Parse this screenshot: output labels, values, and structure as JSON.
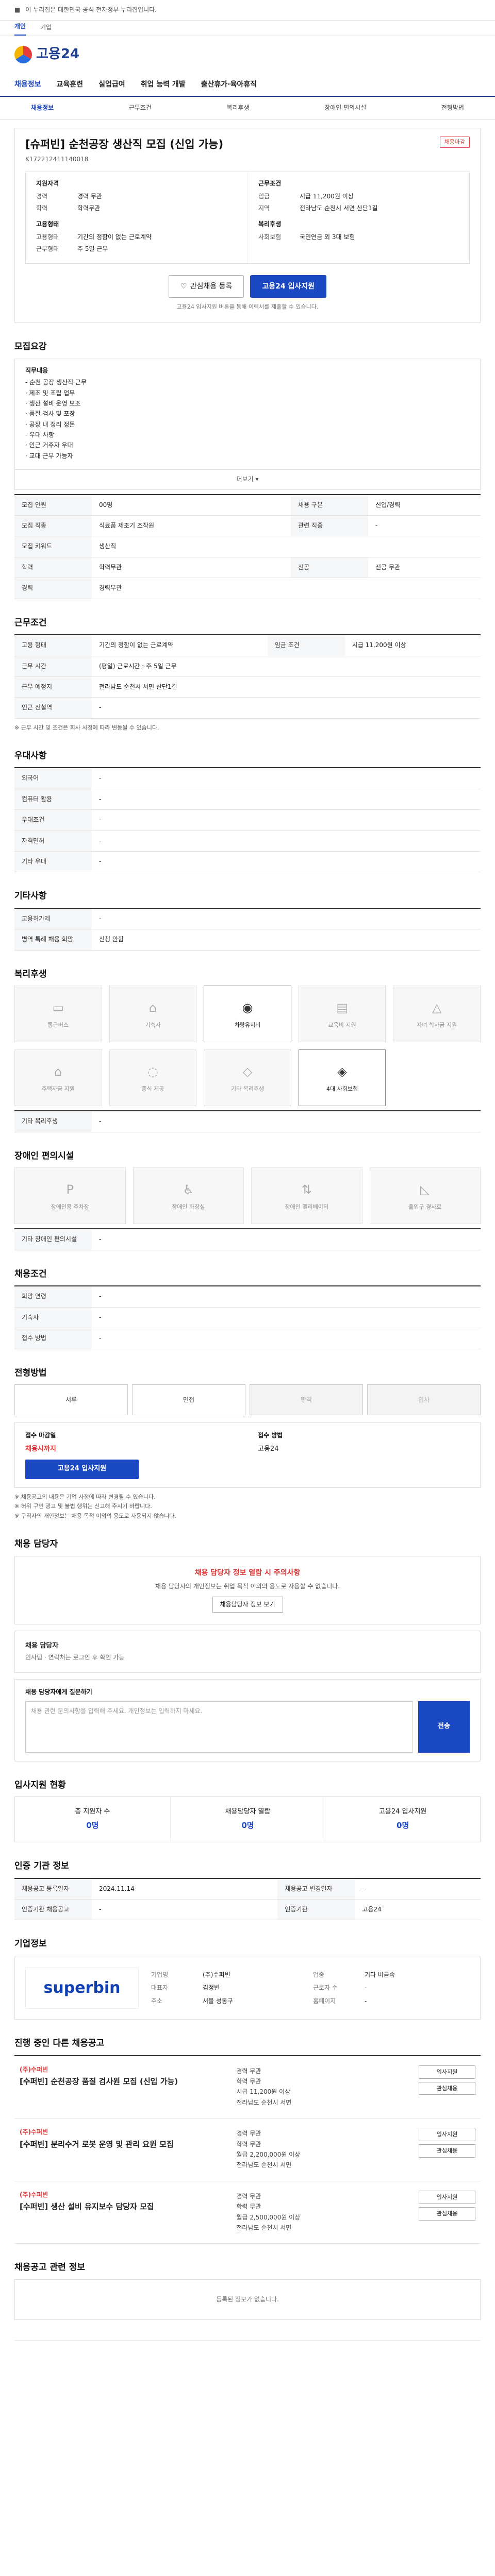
{
  "topbar": {
    "text": "이 누리집은 대한민국 공식 전자정부 누리집입니다."
  },
  "subtabs": [
    "개인",
    "기업"
  ],
  "logo": "고용24",
  "gnb": [
    "채용정보",
    "교육훈련",
    "실업급여",
    "취업 능력 개발",
    "출산휴가·육아휴직"
  ],
  "lnb": [
    "채용정보",
    "근무조건",
    "복리후생",
    "장애인 편의시설",
    "전형방법"
  ],
  "job": {
    "title": "[슈퍼빈] 순천공장 생산직 모집 (신입 가능)",
    "badge": "채용마감",
    "reg_no": "K172212411140018"
  },
  "summary": {
    "left_head": "지원자격",
    "left": [
      [
        "경력",
        "경력 무관"
      ],
      [
        "학력",
        "학력무관"
      ]
    ],
    "right_head": "근무조건",
    "right": [
      [
        "임금",
        "시급 11,200원 이상"
      ],
      [
        "지역",
        "전라남도 순천시 서면 산단1길"
      ]
    ],
    "left2_head": "고용형태",
    "left2": [
      [
        "고용형태",
        "기간의 정함이 없는 근로계약"
      ],
      [
        "근무형태",
        "주 5일 근무"
      ]
    ],
    "right2_head": "복리후생",
    "right2": [
      [
        "사회보험",
        "국민연금 외 3대 보험"
      ]
    ]
  },
  "buttons": {
    "interest": "관심채용 등록",
    "apply": "고용24 입사지원"
  },
  "note": "고용24 입사지원 버튼을 통해 이력서를 제출할 수 있습니다.",
  "sec1": {
    "title": "모집요강",
    "work": "직무내용",
    "items": [
      "- 순천 공장 생산직 근무",
      "  · 제조 및 조립 업무",
      "  · 생산 설비 운영 보조",
      "  · 품질 검사 및 포장",
      "  · 공장 내 정리 정돈",
      "- 우대 사항",
      "  · 인근 거주자 우대",
      "  · 교대 근무 가능자"
    ],
    "more": "더보기 ▾"
  },
  "rows1": [
    [
      "모집 인원",
      "00명",
      "채용 구분",
      "신입/경력"
    ],
    [
      "모집 직종",
      "식료품 제조기 조작원",
      "관련 직종",
      "-"
    ],
    [
      "모집 키워드",
      "생산직"
    ],
    [
      "학력",
      "학력무관",
      "전공",
      "전공 무관"
    ],
    [
      "경력",
      "경력무관"
    ]
  ],
  "sec2": {
    "title": "근무조건"
  },
  "rows2": [
    [
      "고용 형태",
      "기간의 정함이 없는 근로계약",
      "임금 조건",
      "시급 11,200원 이상"
    ],
    [
      "근무 시간",
      "(평일) 근로시간 : 주 5일 근무",
      "",
      ""
    ],
    [
      "근무 예정지",
      "전라남도 순천시 서면 산단1길",
      "",
      ""
    ],
    [
      "인근 전철역",
      "-",
      "",
      ""
    ]
  ],
  "rows2_note": "※ 근무 시간 및 조건은 회사 사정에 따라 변동될 수 있습니다.",
  "sec3": {
    "title": "우대사항"
  },
  "rows3": [
    [
      "외국어",
      "-"
    ],
    [
      "컴퓨터 활용",
      "-"
    ],
    [
      "우대조건",
      "-"
    ],
    [
      "자격면허",
      "-"
    ],
    [
      "기타 우대",
      "-"
    ]
  ],
  "sec4": {
    "title": "기타사항"
  },
  "rows4": [
    [
      "고용허가제",
      "-"
    ],
    [
      "병역 특례 채용 희망",
      "신청 안함"
    ]
  ],
  "sec5": {
    "title": "복리후생",
    "items": [
      "통근버스",
      "기숙사",
      "차량유지비",
      "교육비 지원",
      "자녀 학자금 지원",
      "주택자금 지원",
      "중식 제공",
      "기타 복리후생",
      "4대 사회보험"
    ],
    "etc_label": "기타 복리후생",
    "etc_value": "-"
  },
  "sec6": {
    "title": "장애인 편의시설",
    "items": [
      "장애인용 주차장",
      "장애인 화장실",
      "장애인 엘리베이터",
      "출입구 경사로"
    ],
    "etc_label": "기타 장애인 편의시설",
    "etc_value": "-"
  },
  "sec7": {
    "title": "채용조건"
  },
  "rows7": [
    [
      "희망 연령",
      "-",
      "",
      " "
    ],
    [
      "기숙사",
      "-",
      "",
      " "
    ],
    [
      "접수 방법",
      "-",
      "",
      " "
    ]
  ],
  "sec8": {
    "title": "전형방법",
    "steps": [
      "서류",
      "면접",
      "합격",
      "입사"
    ],
    "left_head": "접수 마감일",
    "left_val": "채용시까지",
    "right_head": "접수 방법",
    "right_val": "고용24",
    "apply": "고용24 입사지원"
  },
  "notices": [
    "※ 채용공고의 내용은 기업 사정에 따라 변경될 수 있습니다.",
    "※ 허위 구인 광고 및 불법 행위는 신고해 주시기 바랍니다.",
    "※ 구직자의 개인정보는 채용 목적 이외의 용도로 사용되지 않습니다."
  ],
  "sec9": {
    "title": "채용 담당자",
    "alert_title": "채용 담당자 정보 열람 시 주의사항",
    "alert_body": "채용 담당자의 개인정보는 취업 목적 이외의 용도로 사용할 수 없습니다.",
    "btn": "채용담당자 정보 보기",
    "contact_name": "채용 담당자",
    "contact_sub": "인사팀 · 연락처는 로그인 후 확인 가능"
  },
  "sec10": {
    "title": "채용 담당자에게 질문하기",
    "placeholder": "채용 관련 문의사항을 입력해 주세요. 개인정보는 입력하지 마세요.",
    "send": "전송"
  },
  "sec11": {
    "title": "입사지원 현황",
    "cols": [
      "총 지원자 수",
      "채용담당자 열람",
      "고용24 입사지원"
    ],
    "vals": [
      "0명",
      "0명",
      "0명"
    ]
  },
  "sec12": {
    "title": "인증 기관 정보",
    "rows": [
      [
        "채용공고 등록일자",
        "2024.11.14",
        "채용공고 변경일자",
        "-"
      ],
      [
        "인증기관 채용공고",
        "-",
        "인증기관",
        "고용24"
      ]
    ]
  },
  "sec13": {
    "title": "기업정보",
    "logo": "superbin",
    "rows": [
      [
        "기업명",
        "(주)수퍼빈",
        "업종",
        "기타 비금속"
      ],
      [
        "대표자",
        "김정빈",
        "근로자 수",
        "-"
      ],
      [
        "주소",
        "서울 성동구",
        "홈페이지",
        "-"
      ]
    ]
  },
  "sec14": {
    "title": "진행 중인 다른 채용공고",
    "list": [
      {
        "company": "(주)수퍼빈",
        "title": "[수퍼빈] 순천공장 품질 검사원 모집 (신입 가능)",
        "info": [
          "경력 무관",
          "학력 무관",
          "시급 11,200원 이상",
          "전라남도 순천시 서면"
        ],
        "btns": [
          "입사지원",
          "관심채용"
        ]
      },
      {
        "company": "(주)수퍼빈",
        "title": "[수퍼빈] 분리수거 로봇 운영 및 관리 요원 모집",
        "info": [
          "경력 무관",
          "학력 무관",
          "월급 2,200,000원 이상",
          "전라남도 순천시 서면"
        ],
        "btns": [
          "입사지원",
          "관심채용"
        ]
      },
      {
        "company": "(주)수퍼빈",
        "title": "[수퍼빈] 생산 설비 유지보수 담당자 모집",
        "info": [
          "경력 무관",
          "학력 무관",
          "월급 2,500,000원 이상",
          "전라남도 순천시 서면"
        ],
        "btns": [
          "입사지원",
          "관심채용"
        ]
      }
    ]
  },
  "sec15": {
    "title": "채용공고 관련 정보",
    "empty": "등록된 정보가 없습니다."
  }
}
